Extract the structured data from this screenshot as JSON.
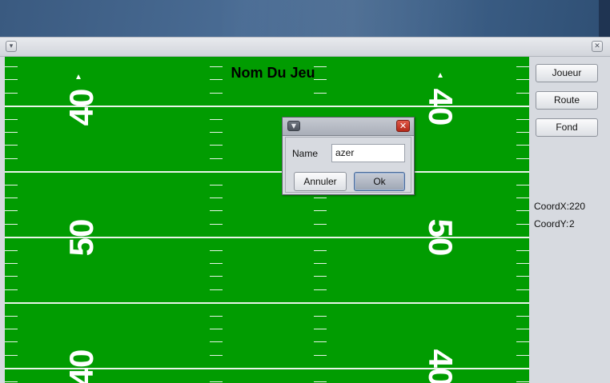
{
  "field": {
    "title": "Nom Du Jeu",
    "yard_numbers": {
      "top": "40",
      "middle": "50",
      "bottom": "40"
    }
  },
  "sidebar": {
    "buttons": [
      "Joueur",
      "Route",
      "Fond"
    ],
    "coord_x_label": "CoordX:",
    "coord_x_value": "220",
    "coord_y_label": "CoordY:",
    "coord_y_value": "2"
  },
  "dialog": {
    "name_label": "Name",
    "name_value": "azer",
    "cancel_label": "Annuler",
    "ok_label": "Ok"
  },
  "window": {
    "menu_icon": "triangle-down-icon",
    "close_icon": "close-icon"
  },
  "colors": {
    "field_green": "#019c01",
    "line_white": "#ffffff",
    "dialog_close_red": "#c0392b"
  }
}
